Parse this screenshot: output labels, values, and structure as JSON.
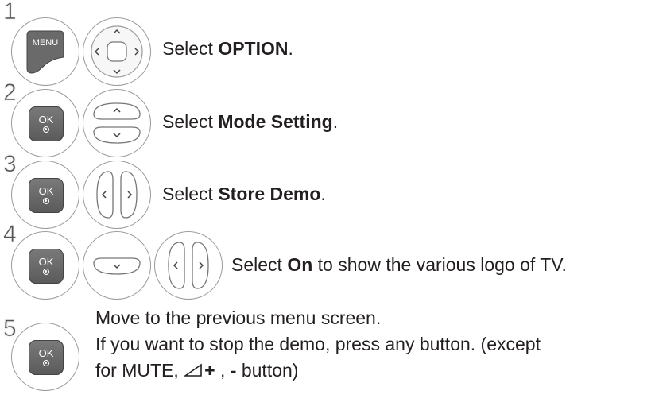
{
  "steps": [
    {
      "number": "1",
      "key_label": "MENU",
      "prefix": "Select ",
      "bold": "OPTION",
      "suffix": "."
    },
    {
      "number": "2",
      "key_label": "OK",
      "prefix": "Select ",
      "bold": "Mode Setting",
      "suffix": "."
    },
    {
      "number": "3",
      "key_label": "OK",
      "prefix": "Select ",
      "bold": "Store Demo",
      "suffix": "."
    },
    {
      "number": "4",
      "key_label": "OK",
      "prefix": "Select ",
      "bold": "On",
      "suffix": " to show the various logo of TV."
    },
    {
      "number": "5",
      "key_label": "OK",
      "line1": "Move to the previous menu screen.",
      "line2": "If you want to stop the demo, press any button. (except",
      "line3_prefix": "for MUTE, ",
      "line3_plus": "+",
      "line3_sep": " , ",
      "line3_minus": "-",
      "line3_suffix": " button)"
    }
  ],
  "icons": [
    "menu-key-icon",
    "dpad-icon",
    "ok-key-icon",
    "up-down-keys-icon",
    "left-right-keys-icon",
    "down-key-icon",
    "volume-icon"
  ]
}
